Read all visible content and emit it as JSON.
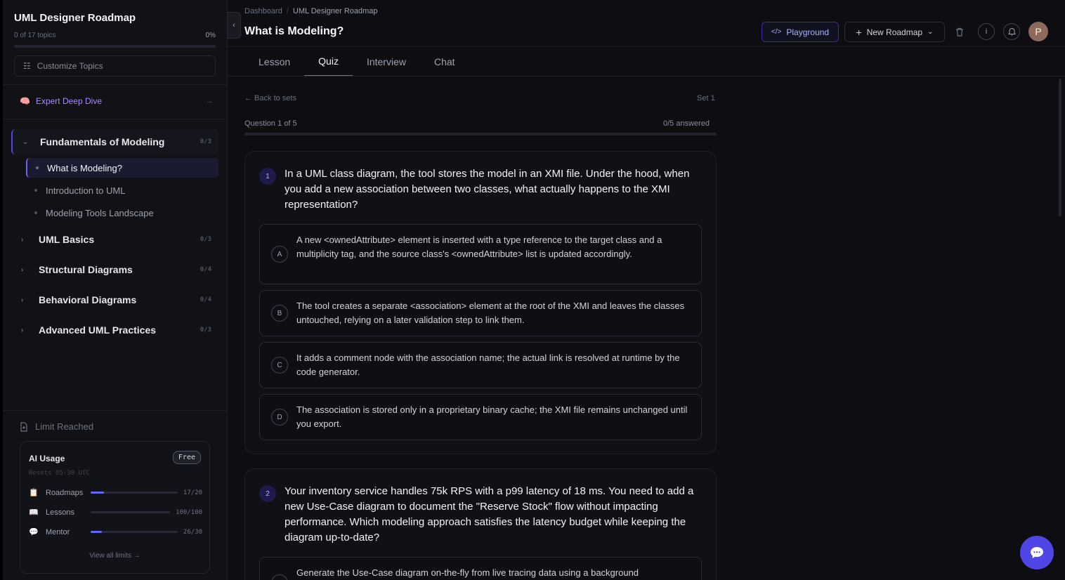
{
  "sidebar": {
    "title": "UML Designer Roadmap",
    "progress_text": "0 of 17 topics",
    "progress_pct": "0%",
    "progress_value": 0,
    "customize_label": "Customize Topics",
    "deep_dive_label": "Expert Deep Dive",
    "deep_dive_arrow": "→",
    "modules": [
      {
        "label": "Fundamentals of Modeling",
        "count": "0/3",
        "expanded": true,
        "lessons": [
          {
            "label": "What is Modeling?"
          },
          {
            "label": "Introduction to UML"
          },
          {
            "label": "Modeling Tools Landscape"
          }
        ]
      },
      {
        "label": "UML Basics",
        "count": "0/3"
      },
      {
        "label": "Structural Diagrams",
        "count": "0/4"
      },
      {
        "label": "Behavioral Diagrams",
        "count": "0/4"
      },
      {
        "label": "Advanced UML Practices",
        "count": "0/3"
      }
    ],
    "limit_label": "Limit Reached",
    "usage": {
      "title": "AI Usage",
      "badge": "Free",
      "reset": "Resets 05:30 UTC",
      "rows": [
        {
          "label": "Roadmaps",
          "value": "17/20",
          "fraction": 0.15,
          "icon": "📋"
        },
        {
          "label": "Lessons",
          "value": "100/100",
          "fraction": 0,
          "icon": "📖"
        },
        {
          "label": "Mentor",
          "value": "26/30",
          "fraction": 0.13,
          "icon": "💬"
        }
      ],
      "view_all": "View all limits →"
    }
  },
  "header": {
    "breadcrumb": [
      "Dashboard",
      "UML Designer Roadmap"
    ],
    "breadcrumb_sep": "/",
    "title": "What is Modeling?",
    "playground_label": "Playground",
    "new_roadmap_label": "New Roadmap",
    "avatar_initial": "P"
  },
  "tabs": [
    "Lesson",
    "Quiz",
    "Interview",
    "Chat"
  ],
  "active_tab": "Quiz",
  "quiz": {
    "back_label": "← Back to sets",
    "set_label": "Set 1",
    "question_counter": "Question 1 of 5",
    "answered_label": "0/5 answered",
    "questions": [
      {
        "number": "1",
        "text": "In a UML class diagram, the tool stores the model in an XMI file. Under the hood, when you add a new association between two classes, what actually happens to the XMI representation?",
        "options": [
          {
            "letter": "A",
            "text": "A new <ownedAttribute> element is inserted with a type reference to the target class and a multiplicity tag, and the source class's <ownedAttribute> list is updated accordingly."
          },
          {
            "letter": "B",
            "text": "The tool creates a separate <association> element at the root of the XMI and leaves the classes untouched, relying on a later validation step to link them."
          },
          {
            "letter": "C",
            "text": "It adds a comment node with the association name; the actual link is resolved at runtime by the code generator."
          },
          {
            "letter": "D",
            "text": "The association is stored only in a proprietary binary cache; the XMI file remains unchanged until you export."
          }
        ]
      },
      {
        "number": "2",
        "text": "Your inventory service handles 75k RPS with a p99 latency of 18 ms. You need to add a new Use-Case diagram to document the \"Reserve Stock\" flow without impacting performance. Which modeling approach satisfies the latency budget while keeping the diagram up-to-date?",
        "options": [
          {
            "letter": "A",
            "text": "Generate the Use-Case diagram on-the-fly from live tracing data using a background"
          }
        ]
      }
    ]
  },
  "colors": {
    "accent": "#6366f1",
    "purple": "#a78bfa",
    "fab": "#4f46e5"
  }
}
